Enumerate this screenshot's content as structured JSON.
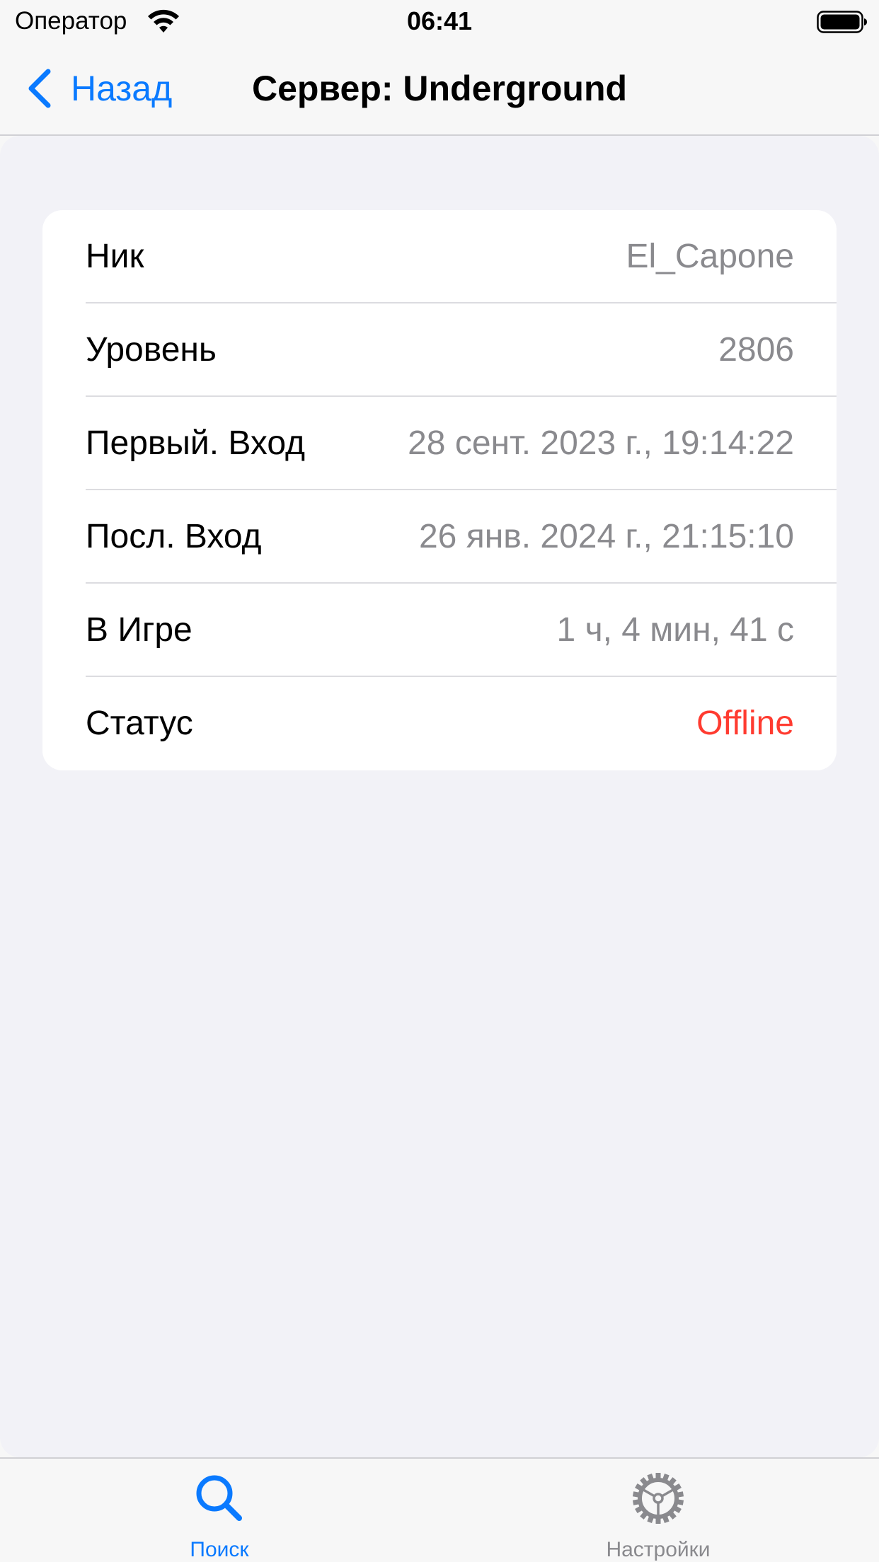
{
  "status_bar": {
    "carrier": "Оператор",
    "time": "06:41",
    "wifi_icon": "wifi-icon",
    "battery_icon": "battery-icon"
  },
  "nav": {
    "back_label": "Назад",
    "title": "Сервер: Underground",
    "accent_color": "#0a7aff"
  },
  "details": {
    "rows": [
      {
        "label": "Ник",
        "value": "El_Capone"
      },
      {
        "label": "Уровень",
        "value": "2806"
      },
      {
        "label": "Первый. Вход",
        "value": "28 сент. 2023 г., 19:14:22"
      },
      {
        "label": "Посл. Вход",
        "value": "26 янв. 2024 г., 21:15:10"
      },
      {
        "label": "В Игре",
        "value": "1 ч, 4 мин, 41 с"
      },
      {
        "label": "Статус",
        "value": "Offline",
        "color": "#ff3b30"
      }
    ]
  },
  "tab_bar": {
    "tabs": [
      {
        "label": "Поиск",
        "icon": "search-icon",
        "selected": true
      },
      {
        "label": "Настройки",
        "icon": "gear-icon",
        "selected": false
      }
    ]
  }
}
